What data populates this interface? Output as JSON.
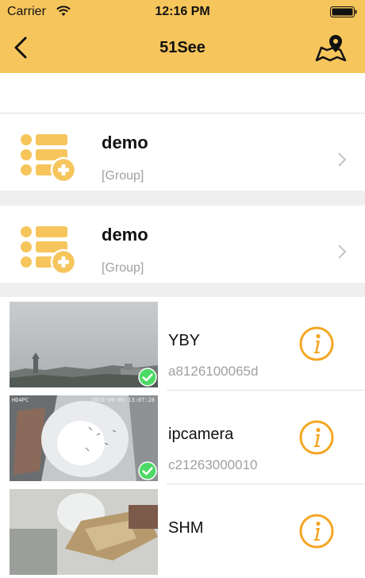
{
  "status_bar": {
    "carrier": "Carrier",
    "time": "12:16 PM"
  },
  "nav": {
    "title": "51See",
    "back_icon": "chevron-left-icon",
    "map_icon": "map-pin-icon"
  },
  "groups": [
    {
      "name": "demo",
      "subtitle": "[Group]"
    },
    {
      "name": "demo",
      "subtitle": "[Group]"
    }
  ],
  "cameras": [
    {
      "name": "YBY",
      "id": "a8126100065d",
      "online": true
    },
    {
      "name": "ipcamera",
      "id": "c21263000010",
      "online": true
    },
    {
      "name": "SHM",
      "id": "",
      "online": false
    }
  ],
  "thumb_overlays": {
    "cam2_left": "HD4PC",
    "cam2_right": "2016-06-09 13:07:28"
  },
  "colors": {
    "accent": "#F6C55C",
    "icon_orange": "#F5A623",
    "online_green": "#4CD964",
    "muted_text": "#A0A0A0"
  }
}
